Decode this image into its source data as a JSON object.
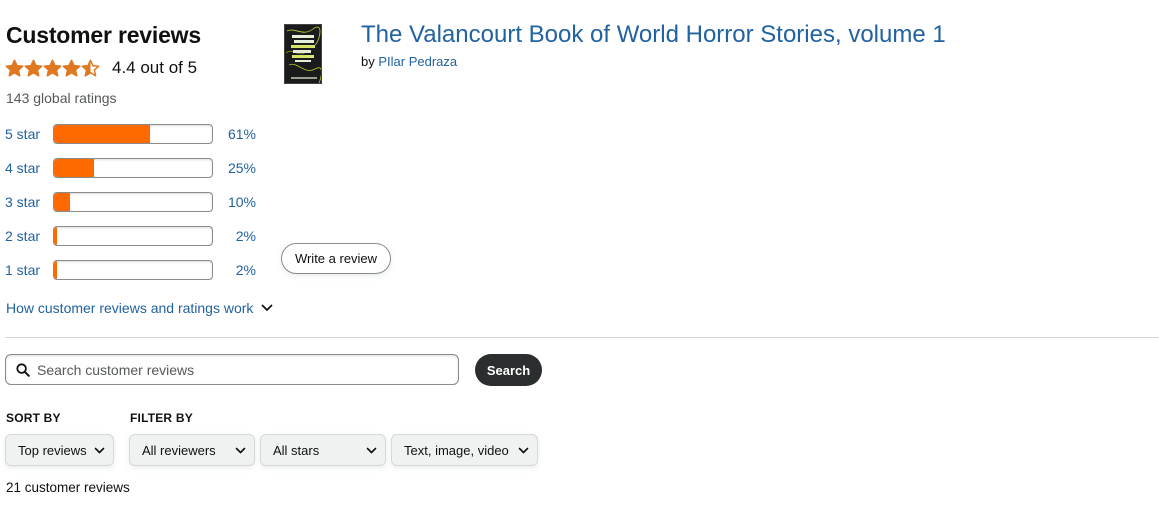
{
  "reviews": {
    "heading": "Customer reviews",
    "rating_text": "4.4 out of 5",
    "average_rating": 4.4,
    "global_ratings": "143 global ratings",
    "histogram": [
      {
        "label": "5 star",
        "percent": 61,
        "percent_text": "61%"
      },
      {
        "label": "4 star",
        "percent": 25,
        "percent_text": "25%"
      },
      {
        "label": "3 star",
        "percent": 10,
        "percent_text": "10%"
      },
      {
        "label": "2 star",
        "percent": 2,
        "percent_text": "2%"
      },
      {
        "label": "1 star",
        "percent": 2,
        "percent_text": "2%"
      }
    ],
    "how_link": "How customer reviews and ratings work",
    "star_color": "#de7921",
    "bar_color": "#ff6a00"
  },
  "product": {
    "title": "The Valancourt Book of World Horror Stories, volume 1",
    "by_prefix": "by",
    "author": "PIlar Pedraza"
  },
  "write_review_label": "Write a review",
  "search": {
    "placeholder": "Search customer reviews",
    "button_label": "Search"
  },
  "sort": {
    "label": "SORT BY",
    "selected": "Top reviews"
  },
  "filter": {
    "label": "FILTER BY",
    "reviewers": "All reviewers",
    "stars": "All stars",
    "media": "Text, image, video"
  },
  "review_count": "21 customer reviews"
}
